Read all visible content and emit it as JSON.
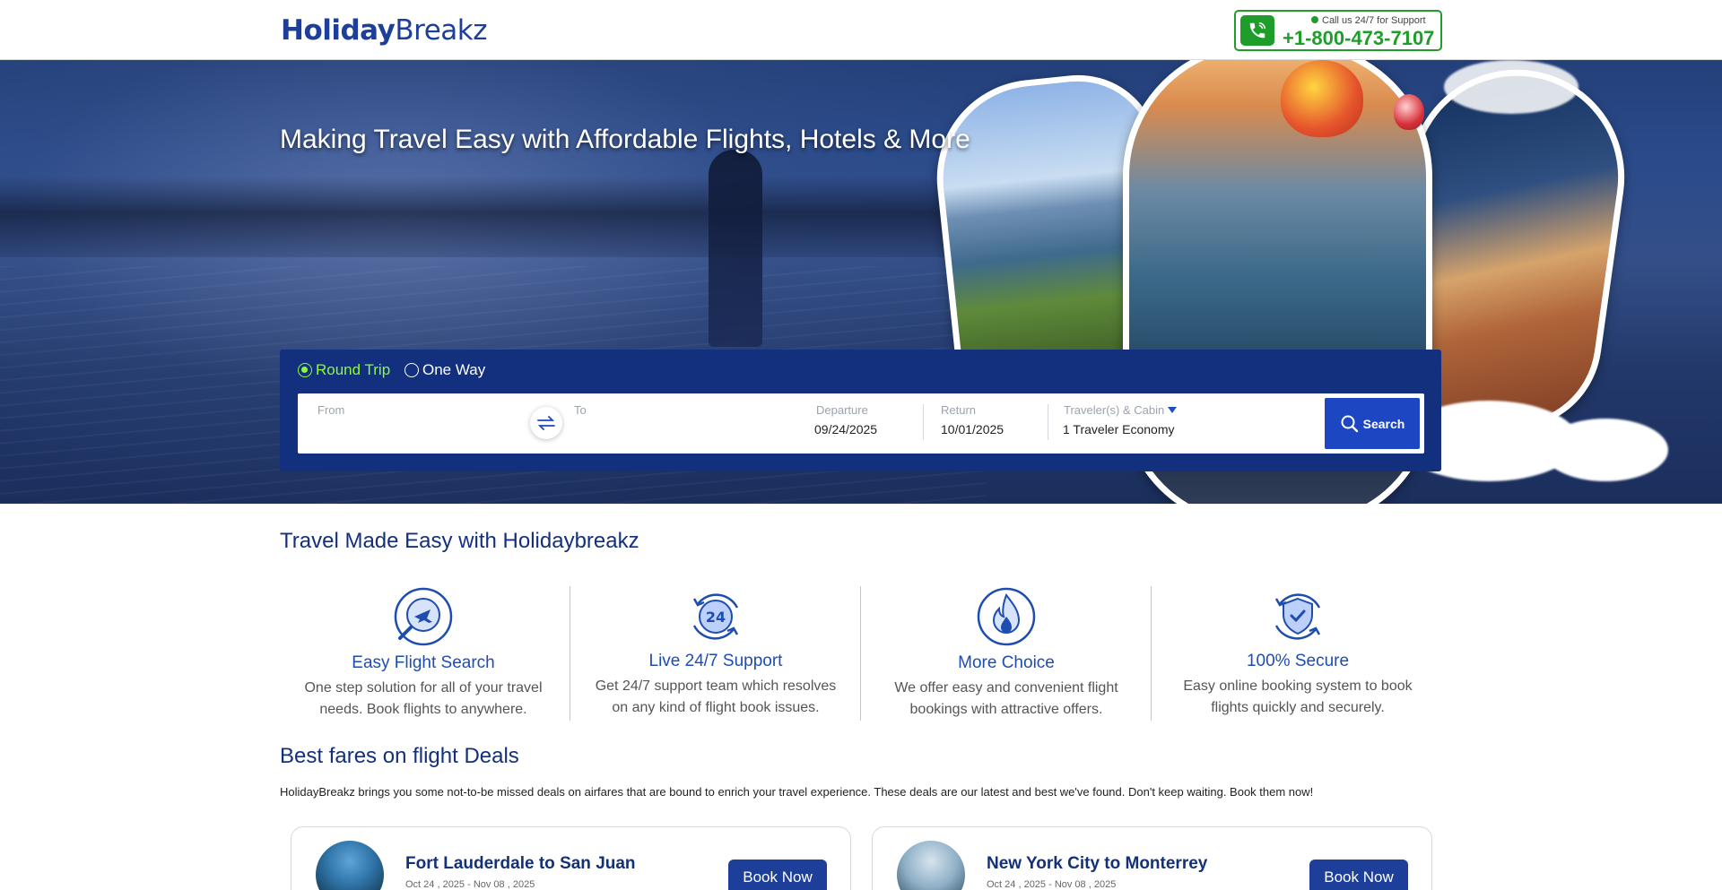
{
  "header": {
    "logo_part1": "Holiday",
    "logo_part2": "Breakz",
    "support_label": "Call us 24/7 for Support",
    "support_phone": "+1-800-473-7107"
  },
  "hero": {
    "title": "Making Travel Easy with Affordable Flights, Hotels & More"
  },
  "search": {
    "trip_round": "Round Trip",
    "trip_oneway": "One Way",
    "from_label": "From",
    "from_value": "",
    "to_label": "To",
    "to_value": "",
    "departure_label": "Departure",
    "departure_value": "09/24/2025",
    "return_label": "Return",
    "return_value": "10/01/2025",
    "travelers_label": "Traveler(s) & Cabin",
    "travelers_value": "1 Traveler Economy",
    "search_button": "Search"
  },
  "features_section": {
    "title": "Travel Made Easy with Holidaybreakz",
    "items": [
      {
        "title": "Easy Flight Search",
        "desc": "One step solution for all of your travel needs. Book flights to anywhere.",
        "icon": "flight-search-icon"
      },
      {
        "title": "Live 24/7 Support",
        "desc": "Get 24/7 support team which resolves on any kind of flight book issues.",
        "icon": "support-24-icon"
      },
      {
        "title": "More Choice",
        "desc": "We offer easy and convenient flight bookings with attractive offers.",
        "icon": "choice-flame-icon"
      },
      {
        "title": "100% Secure",
        "desc": "Easy online booking system to book flights quickly and securely.",
        "icon": "secure-shield-icon"
      }
    ]
  },
  "deals_section": {
    "title": "Best fares on flight Deals",
    "description": "HolidayBreakz brings you some not-to-be missed deals on airfares that are bound to enrich your travel experience. These deals are our latest and best we've found. Don't keep waiting. Book them now!",
    "deals": [
      {
        "route": "Fort Lauderdale to San Juan",
        "dates": "Oct 24 , 2025 - Nov 08 , 2025",
        "button": "Book Now"
      },
      {
        "route": "New York City to Monterrey",
        "dates": "Oct 24 , 2025 - Nov 08 , 2025",
        "button": "Book Now"
      }
    ]
  },
  "colors": {
    "brand_blue": "#1d3f99",
    "panel_navy": "#12307d",
    "support_green": "#1f9d2b",
    "active_radio": "#8cf93a"
  }
}
